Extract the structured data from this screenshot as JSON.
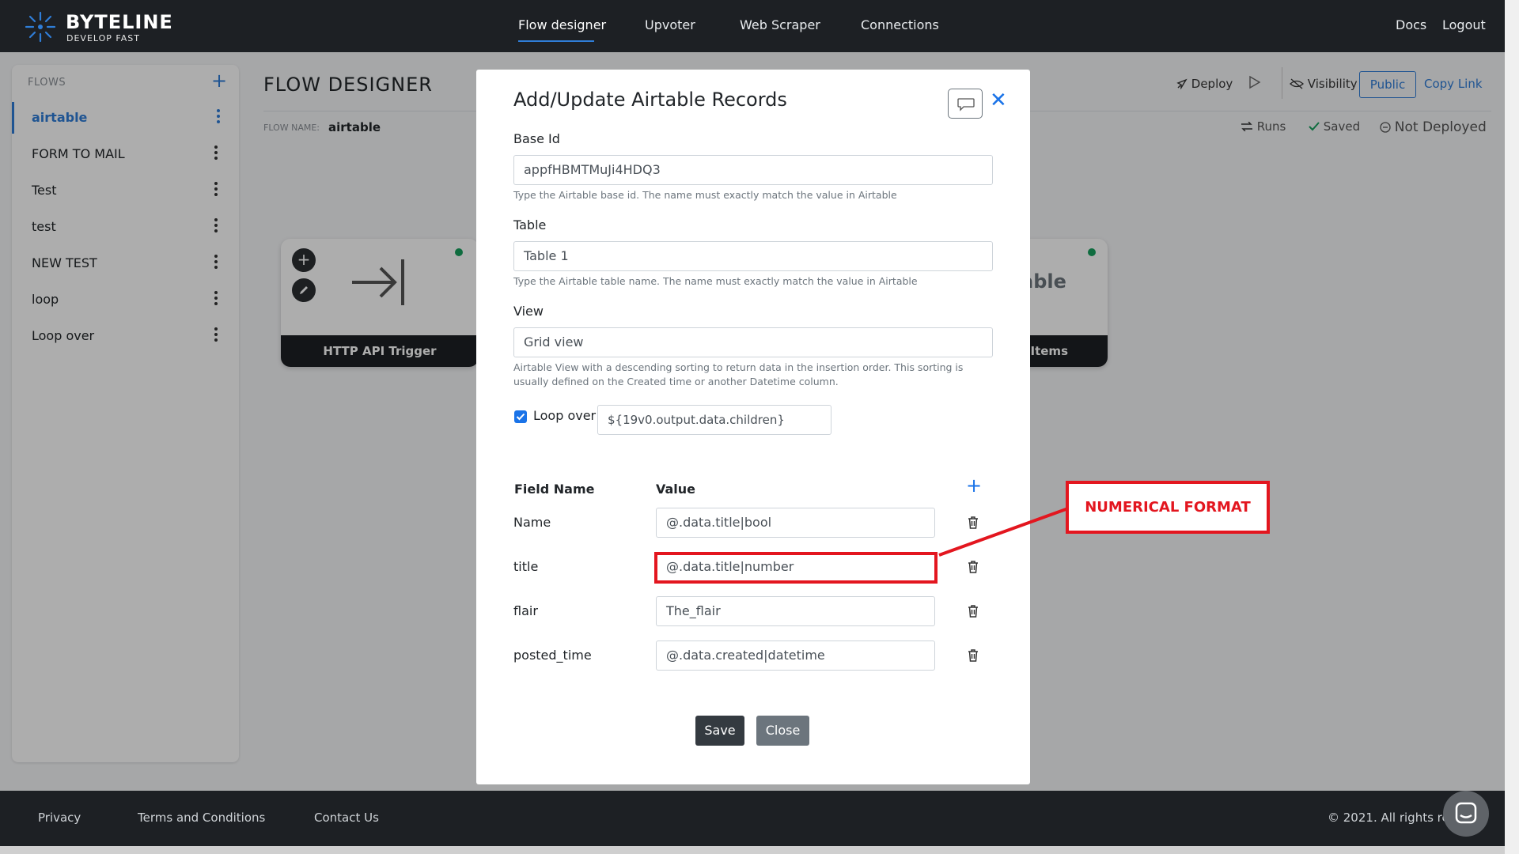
{
  "brand": {
    "name": "BYTELINE",
    "tagline": "DEVELOP FAST"
  },
  "nav": {
    "links": [
      "Flow designer",
      "Upvoter",
      "Web Scraper",
      "Connections"
    ],
    "right": [
      "Docs",
      "Logout"
    ]
  },
  "sidebar": {
    "header": "FLOWS",
    "add_icon": "+",
    "items": [
      {
        "label": "airtable",
        "active": true
      },
      {
        "label": "FORM TO MAIL",
        "active": false
      },
      {
        "label": "Test",
        "active": false
      },
      {
        "label": "test",
        "active": false
      },
      {
        "label": "NEW TEST",
        "active": false
      },
      {
        "label": "loop",
        "active": false
      },
      {
        "label": "Loop over",
        "active": false
      }
    ]
  },
  "main": {
    "title": "FLOW DESIGNER",
    "flow_name_label": "FLOW NAME:",
    "flow_name": "airtable",
    "toolbar": {
      "deploy": "Deploy",
      "visibility": "Visibility",
      "public": "Public",
      "copy_link": "Copy Link",
      "runs": "Runs",
      "saved": "Saved",
      "not_deployed": "Not Deployed"
    },
    "nodes": [
      {
        "title": "HTTP API Trigger"
      },
      {
        "title": "rt Items",
        "body_text": "able"
      }
    ]
  },
  "modal": {
    "title": "Add/Update Airtable Records",
    "base_id": {
      "label": "Base Id",
      "value": "appfHBMTMuJi4HDQ3",
      "help": "Type the Airtable base id. The name must exactly match the value in Airtable"
    },
    "table": {
      "label": "Table",
      "value": "Table 1",
      "help": "Type the Airtable table name. The name must exactly match the value in Airtable"
    },
    "view": {
      "label": "View",
      "value": "Grid view",
      "help": "Airtable View with a descending sorting to return data in the insertion order. This sorting is usually defined on the Created time or another Datetime column."
    },
    "loop": {
      "label": "Loop over",
      "checked": true,
      "value": "${19v0.output.data.children}"
    },
    "fields": {
      "col_name": "Field Name",
      "col_value": "Value",
      "rows": [
        {
          "name": "Name",
          "value": "@.data.title|bool"
        },
        {
          "name": "title",
          "value": "@.data.title|number"
        },
        {
          "name": "flair",
          "value": "The_flair"
        },
        {
          "name": "posted_time",
          "value": "@.data.created|datetime"
        }
      ]
    },
    "buttons": {
      "save": "Save",
      "close": "Close"
    }
  },
  "annotation": {
    "label": "NUMERICAL FORMAT",
    "color": "#e3161f"
  },
  "footer": {
    "links": [
      "Privacy",
      "Terms and Conditions",
      "Contact Us"
    ],
    "copyright": "© 2021. All rights rese"
  },
  "colors": {
    "accent": "#2f7dd7",
    "dark": "#1d2024",
    "status_green": "#17a05d"
  }
}
